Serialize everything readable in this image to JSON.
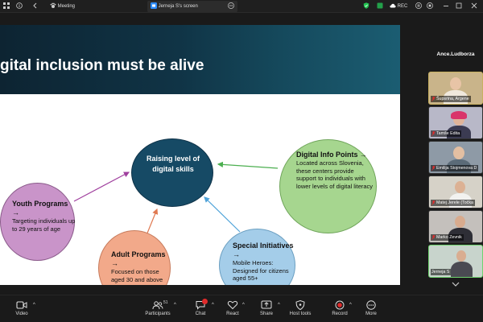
{
  "topbar": {
    "meeting_label": "Meeting",
    "screen_tab_label": "Jerneja S's screen",
    "rec_label": "REC"
  },
  "slide": {
    "title": "gital inclusion must be alive",
    "center": {
      "title": "Raising level of digital skills"
    },
    "digital_info_points": {
      "title": "Digital Info Points",
      "arrow": "→",
      "desc": "Located across Slovenia, these centers provide support to individuals with lower levels of digital literacy"
    },
    "youth_programs": {
      "title": "Youth Programs",
      "arrow": "→",
      "desc": "Targeting individuals up to 29 years of age"
    },
    "adult_programs": {
      "title": "Adult Programs",
      "arrow": "→",
      "desc": "Focused on those aged 30 and above"
    },
    "special_initiatives": {
      "title": "Special Initiatives",
      "arrow": "→",
      "desc": "Mobile Heroes: Designed for citizens aged 55+"
    }
  },
  "panel": {
    "header": "Ance.Ludborza",
    "participants": [
      {
        "name": "Ance.Ludborza"
      },
      {
        "name": "Šupsrina, Argene"
      },
      {
        "name": "Tamše Edita"
      },
      {
        "name": "Emilija Stojmenova D"
      },
      {
        "name": "Matej Jerele (Točka"
      },
      {
        "name": "Marko Zevnik"
      },
      {
        "name": "Jerneja S"
      }
    ]
  },
  "toolbar": {
    "video_label": "Video",
    "participants_label": "Participants",
    "participants_count": "51",
    "chat_label": "Chat",
    "react_label": "React",
    "share_label": "Share",
    "host_tools_label": "Host tools",
    "record_label": "Record",
    "more_label": "More"
  },
  "colors": {
    "center_node": "#164a65",
    "right_node": "#a6d68f",
    "left_node": "#c994c9",
    "bottom_left_node": "#f2a98a",
    "bottom_right_node": "#a4cde9",
    "active_speaker_border": "#6fd36f",
    "record_red": "#e02b2b"
  }
}
